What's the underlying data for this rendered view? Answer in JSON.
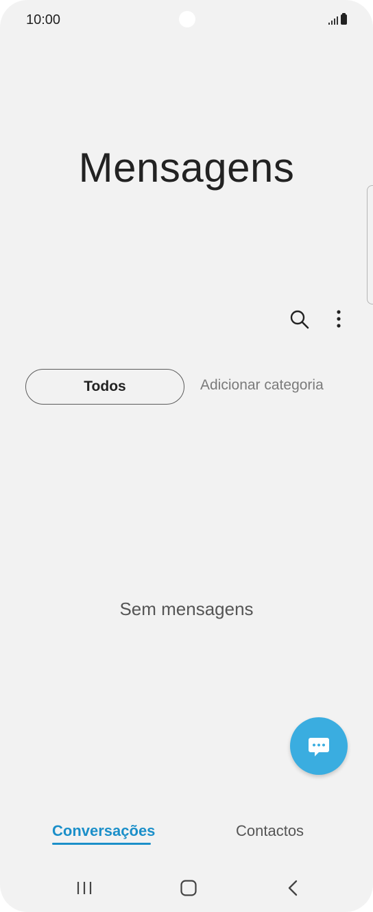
{
  "status_bar": {
    "time": "10:00"
  },
  "app": {
    "title": "Mensagens"
  },
  "toolbar": {
    "search_icon": "search-icon",
    "more_icon": "more-vertical-icon"
  },
  "categories": {
    "active": "Todos",
    "add_label": "Adicionar categoria"
  },
  "content": {
    "empty_text": "Sem mensagens"
  },
  "fab": {
    "icon": "chat-bubble-icon",
    "color": "#3aade0"
  },
  "bottom_tabs": [
    {
      "label": "Conversações",
      "active": true
    },
    {
      "label": "Contactos",
      "active": false
    }
  ],
  "colors": {
    "accent": "#1b8fc9",
    "background": "#f2f2f2"
  }
}
